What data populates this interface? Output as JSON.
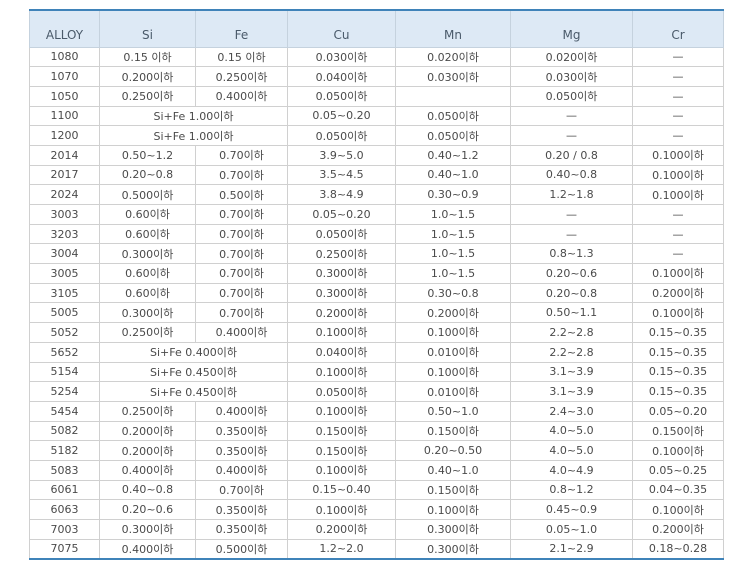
{
  "table": {
    "headers": [
      "ALLOY",
      "Si",
      "Fe",
      "Cu",
      "Mn",
      "Mg",
      "Cr"
    ],
    "rows": [
      [
        "1080",
        "0.15 이하",
        "0.15 이하",
        "0.030이하",
        "0.020이하",
        "0.020이하",
        "—"
      ],
      [
        "1070",
        "0.200이하",
        "0.250이하",
        "0.040이하",
        "0.030이하",
        "0.030이하",
        "—"
      ],
      [
        "1050",
        "0.250이하",
        "0.400이하",
        "0.050이하",
        "",
        "0.050이하",
        "—"
      ],
      [
        "1100",
        "Si+Fe 1.00이하",
        null,
        "0.05~0.20",
        "0.050이하",
        "—",
        "—"
      ],
      [
        "1200",
        "Si+Fe 1.00이하",
        null,
        "0.050이하",
        "0.050이하",
        "—",
        "—"
      ],
      [
        "2014",
        "0.50~1.2",
        "0.70이하",
        "3.9~5.0",
        "0.40~1.2",
        "0.20 / 0.8",
        "0.100이하"
      ],
      [
        "2017",
        "0.20~0.8",
        "0.70이하",
        "3.5~4.5",
        "0.40~1.0",
        "0.40~0.8",
        "0.100이하"
      ],
      [
        "2024",
        "0.500이하",
        "0.50이하",
        "3.8~4.9",
        "0.30~0.9",
        "1.2~1.8",
        "0.100이하"
      ],
      [
        "3003",
        "0.60이하",
        "0.70이하",
        "0.05~0.20",
        "1.0~1.5",
        "—",
        "—"
      ],
      [
        "3203",
        "0.60이하",
        "0.70이하",
        "0.050이하",
        "1.0~1.5",
        "—",
        "—"
      ],
      [
        "3004",
        "0.300이하",
        "0.70이하",
        "0.250이하",
        "1.0~1.5",
        "0.8~1.3",
        "—"
      ],
      [
        "3005",
        "0.60이하",
        "0.70이하",
        "0.300이하",
        "1.0~1.5",
        "0.20~0.6",
        "0.100이하"
      ],
      [
        "3105",
        "0.60이하",
        "0.70이하",
        "0.300이하",
        "0.30~0.8",
        "0.20~0.8",
        "0.200이하"
      ],
      [
        "5005",
        "0.300이하",
        "0.70이하",
        "0.200이하",
        "0.200이하",
        "0.50~1.1",
        "0.100이하"
      ],
      [
        "5052",
        "0.250이하",
        "0.400이하",
        "0.100이하",
        "0.100이하",
        "2.2~2.8",
        "0.15~0.35"
      ],
      [
        "5652",
        "Si+Fe 0.400이하",
        null,
        "0.040이하",
        "0.010이하",
        "2.2~2.8",
        "0.15~0.35"
      ],
      [
        "5154",
        "Si+Fe 0.450이하",
        null,
        "0.100이하",
        "0.100이하",
        "3.1~3.9",
        "0.15~0.35"
      ],
      [
        "5254",
        "Si+Fe 0.450이하",
        null,
        "0.050이하",
        "0.010이하",
        "3.1~3.9",
        "0.15~0.35"
      ],
      [
        "5454",
        "0.250이하",
        "0.400이하",
        "0.100이하",
        "0.50~1.0",
        "2.4~3.0",
        "0.05~0.20"
      ],
      [
        "5082",
        "0.200이하",
        "0.350이하",
        "0.150이하",
        "0.150이하",
        "4.0~5.0",
        "0.150이하"
      ],
      [
        "5182",
        "0.200이하",
        "0.350이하",
        "0.150이하",
        "0.20~0.50",
        "4.0~5.0",
        "0.100이하"
      ],
      [
        "5083",
        "0.400이하",
        "0.400이하",
        "0.100이하",
        "0.40~1.0",
        "4.0~4.9",
        "0.05~0.25"
      ],
      [
        "6061",
        "0.40~0.8",
        "0.70이하",
        "0.15~0.40",
        "0.150이하",
        "0.8~1.2",
        "0.04~0.35"
      ],
      [
        "6063",
        "0.20~0.6",
        "0.350이하",
        "0.100이하",
        "0.100이하",
        "0.45~0.9",
        "0.100이하"
      ],
      [
        "7003",
        "0.300이하",
        "0.350이하",
        "0.200이하",
        "0.300이하",
        "0.05~1.0",
        "0.200이하"
      ],
      [
        "7075",
        "0.400이하",
        "0.500이하",
        "1.2~2.0",
        "0.300이하",
        "2.1~2.9",
        "0.18~0.28"
      ]
    ]
  }
}
